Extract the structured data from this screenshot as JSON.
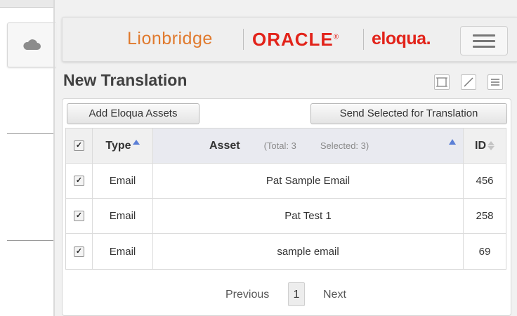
{
  "header": {
    "logo_lionbridge": "Lionbridge",
    "logo_oracle": "ORACLE",
    "logo_oracle_mark": "®",
    "logo_eloqua": "eloqua."
  },
  "page": {
    "title": "New Translation"
  },
  "toolbar": {
    "add_assets_label": "Add Eloqua Assets",
    "send_selected_label": "Send Selected for Translation"
  },
  "grid": {
    "columns": {
      "type": "Type",
      "asset": "Asset",
      "id": "ID"
    },
    "total_label": "(Total: 3",
    "selected_label": "Selected: 3)",
    "rows": [
      {
        "checked": "✓",
        "type": "Email",
        "asset": "Pat Sample Email",
        "id": "456"
      },
      {
        "checked": "✓",
        "type": "Email",
        "asset": "Pat Test 1",
        "id": "258"
      },
      {
        "checked": "✓",
        "type": "Email",
        "asset": "sample email",
        "id": "69"
      }
    ],
    "header_check": "✓"
  },
  "pager": {
    "previous": "Previous",
    "page": "1",
    "next": "Next"
  },
  "colors": {
    "lionbridge": "#e07a2e",
    "oracle": "#e2231a",
    "sort_accent": "#5b7fd6"
  }
}
